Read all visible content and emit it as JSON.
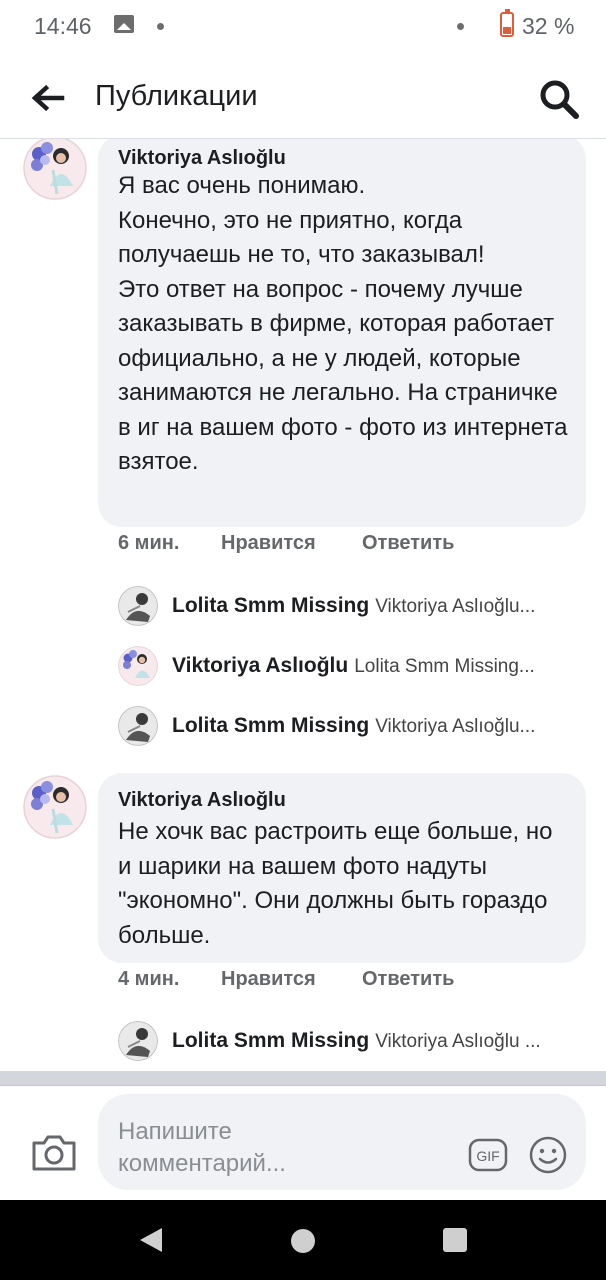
{
  "status_bar": {
    "time": "14:46",
    "battery": "32 %"
  },
  "header": {
    "title": "Публикации"
  },
  "comments": [
    {
      "author": "Viktoriya Aslıoğlu",
      "text": "Я вас очень понимаю.\nКонечно,  это не приятно,  когда получаешь не то, что заказывал!\nЭто ответ на вопрос - почему лучше заказывать в фирме, которая работает официально, а не у людей,  которые занимаются не легально. На страничке в иг на вашем фото -  фото из интернета взятое.",
      "time": "6 мин.",
      "like_label": "Нравится",
      "reply_label": "Ответить",
      "replies": [
        {
          "author": "Lolita Smm Missing",
          "preview": "Viktoriya Aslıoğlu..."
        },
        {
          "author": "Viktoriya Aslıoğlu",
          "preview": "Lolita Smm Missing..."
        },
        {
          "author": "Lolita Smm Missing",
          "preview": "Viktoriya Aslıoğlu..."
        }
      ]
    },
    {
      "author": "Viktoriya Aslıoğlu",
      "text": "Не хочк вас растроить еще больше, но и шарики на вашем фото надуты \"экономно\". Они должны быть гораздо больше.",
      "time": "4 мин.",
      "like_label": "Нравится",
      "reply_label": "Ответить",
      "replies": [
        {
          "author": "Lolita Smm Missing",
          "preview": "Viktoriya Aslıoğlu ..."
        }
      ]
    }
  ],
  "composer": {
    "placeholder": "Напишите комментарий..."
  },
  "gif_label": "GIF",
  "icons": {
    "back": "arrow-left-icon",
    "search": "search-icon",
    "camera": "camera-icon",
    "gif": "gif-icon",
    "emoji": "emoji-icon"
  }
}
